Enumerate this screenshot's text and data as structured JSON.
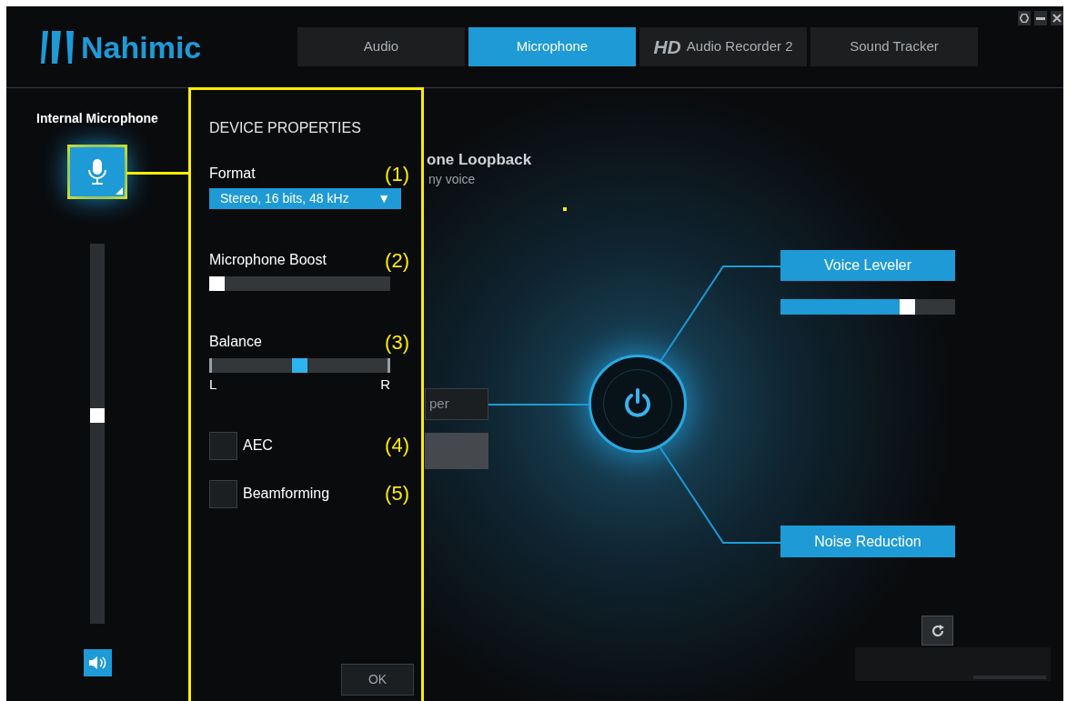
{
  "logo": {
    "text": "Nahimic"
  },
  "tabs": [
    {
      "label": "Audio",
      "selected": false
    },
    {
      "label": "Microphone",
      "selected": true
    },
    {
      "prefix": "HD",
      "label": "Audio Recorder 2",
      "selected": false
    },
    {
      "label": "Sound Tracker",
      "selected": false
    }
  ],
  "device": {
    "name": "Internal Microphone",
    "volume": {
      "level": 0.55
    }
  },
  "background": {
    "loopback_title": "one Loopback",
    "loopback_subtitle": "ny voice",
    "button_1": "per"
  },
  "power": {
    "on": true
  },
  "effects": [
    {
      "label": "Voice Leveler",
      "level": 0.77
    },
    {
      "label": "Noise Reduction"
    }
  ],
  "device_properties": {
    "title": "DEVICE PROPERTIES",
    "format": {
      "label": "Format",
      "value": "Stereo, 16 bits, 48 kHz",
      "arrow": "▼",
      "marker": "(1)"
    },
    "boost": {
      "label": "Microphone Boost",
      "level": 0,
      "marker": "(2)"
    },
    "balance": {
      "label": "Balance",
      "level": 0.5,
      "left": "L",
      "right": "R",
      "marker": "(3)"
    },
    "options": [
      {
        "label": "AEC",
        "checked": false,
        "marker": "(4)"
      },
      {
        "label": "Beamforming",
        "checked": false,
        "marker": "(5)"
      }
    ],
    "ok": "OK"
  }
}
